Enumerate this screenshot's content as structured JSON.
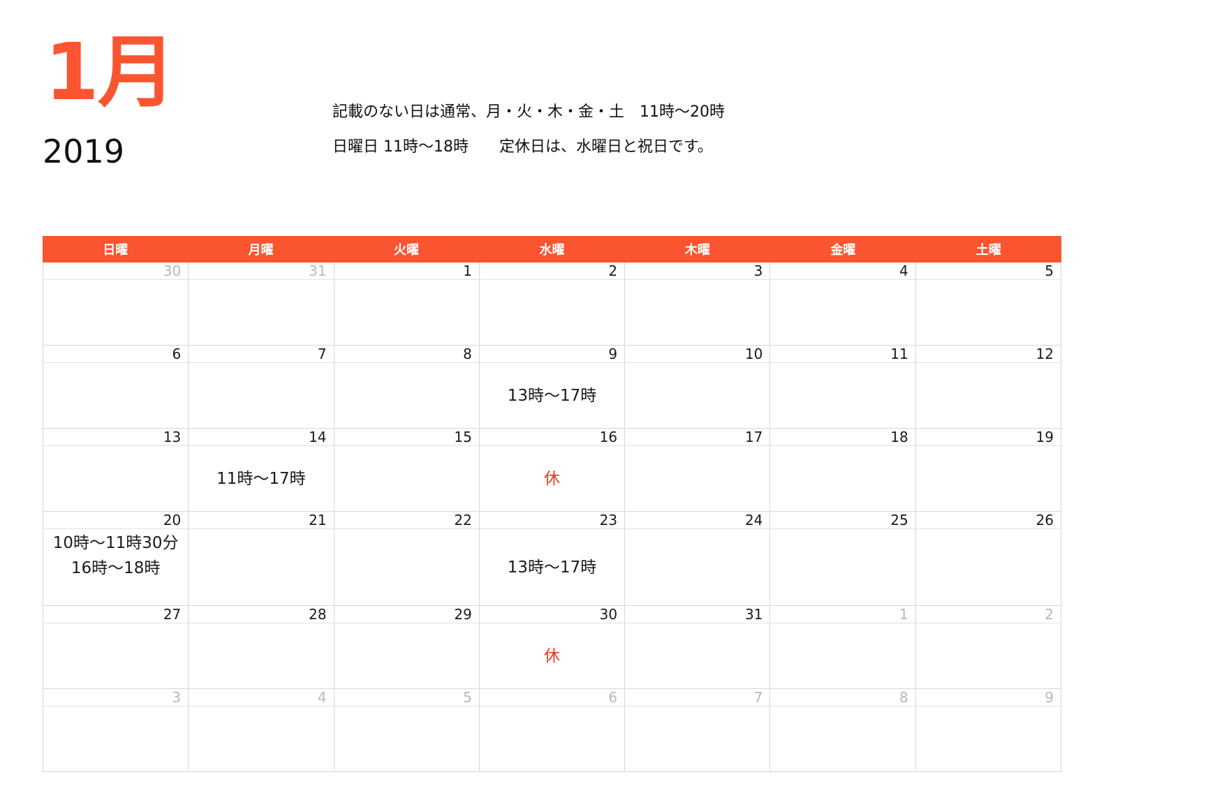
{
  "month": "1月",
  "year": "2019",
  "notes": [
    "記載のない日は通常、月・火・木・金・土　11時〜20時",
    "日曜日 11時〜18時　　定休日は、水曜日と祝日です。"
  ],
  "weekdays": [
    "日曜",
    "月曜",
    "火曜",
    "水曜",
    "木曜",
    "金曜",
    "土曜"
  ],
  "colors": {
    "accent": "#fa5430",
    "closed_text": "#e53a1e",
    "outside_month_number": "#b8b8b8",
    "grid_line": "#d6d6d6"
  },
  "weeks": [
    {
      "days": [
        {
          "num": "30",
          "outside": true,
          "lines": []
        },
        {
          "num": "31",
          "outside": true,
          "lines": []
        },
        {
          "num": "1",
          "outside": false,
          "lines": []
        },
        {
          "num": "2",
          "outside": false,
          "lines": []
        },
        {
          "num": "3",
          "outside": false,
          "lines": []
        },
        {
          "num": "4",
          "outside": false,
          "lines": []
        },
        {
          "num": "5",
          "outside": false,
          "lines": []
        }
      ]
    },
    {
      "days": [
        {
          "num": "6",
          "outside": false,
          "lines": []
        },
        {
          "num": "7",
          "outside": false,
          "lines": []
        },
        {
          "num": "8",
          "outside": false,
          "lines": []
        },
        {
          "num": "9",
          "outside": false,
          "lines": [
            "13時〜17時"
          ]
        },
        {
          "num": "10",
          "outside": false,
          "lines": []
        },
        {
          "num": "11",
          "outside": false,
          "lines": []
        },
        {
          "num": "12",
          "outside": false,
          "lines": []
        }
      ]
    },
    {
      "days": [
        {
          "num": "13",
          "outside": false,
          "lines": []
        },
        {
          "num": "14",
          "outside": false,
          "lines": [
            "11時〜17時"
          ]
        },
        {
          "num": "15",
          "outside": false,
          "lines": []
        },
        {
          "num": "16",
          "outside": false,
          "lines": [
            "休"
          ],
          "closed": true
        },
        {
          "num": "17",
          "outside": false,
          "lines": []
        },
        {
          "num": "18",
          "outside": false,
          "lines": []
        },
        {
          "num": "19",
          "outside": false,
          "lines": []
        }
      ]
    },
    {
      "days": [
        {
          "num": "20",
          "outside": false,
          "lines": [
            "10時〜11時30分",
            "16時〜18時"
          ],
          "align": "top"
        },
        {
          "num": "21",
          "outside": false,
          "lines": []
        },
        {
          "num": "22",
          "outside": false,
          "lines": []
        },
        {
          "num": "23",
          "outside": false,
          "lines": [
            "13時〜17時"
          ]
        },
        {
          "num": "24",
          "outside": false,
          "lines": []
        },
        {
          "num": "25",
          "outside": false,
          "lines": []
        },
        {
          "num": "26",
          "outside": false,
          "lines": []
        }
      ]
    },
    {
      "days": [
        {
          "num": "27",
          "outside": false,
          "lines": []
        },
        {
          "num": "28",
          "outside": false,
          "lines": []
        },
        {
          "num": "29",
          "outside": false,
          "lines": []
        },
        {
          "num": "30",
          "outside": false,
          "lines": [
            "休"
          ],
          "closed": true
        },
        {
          "num": "31",
          "outside": false,
          "lines": []
        },
        {
          "num": "1",
          "outside": true,
          "lines": []
        },
        {
          "num": "2",
          "outside": true,
          "lines": []
        }
      ]
    },
    {
      "days": [
        {
          "num": "3",
          "outside": true,
          "lines": []
        },
        {
          "num": "4",
          "outside": true,
          "lines": []
        },
        {
          "num": "5",
          "outside": true,
          "lines": []
        },
        {
          "num": "6",
          "outside": true,
          "lines": []
        },
        {
          "num": "7",
          "outside": true,
          "lines": []
        },
        {
          "num": "8",
          "outside": true,
          "lines": []
        },
        {
          "num": "9",
          "outside": true,
          "lines": []
        }
      ]
    }
  ]
}
